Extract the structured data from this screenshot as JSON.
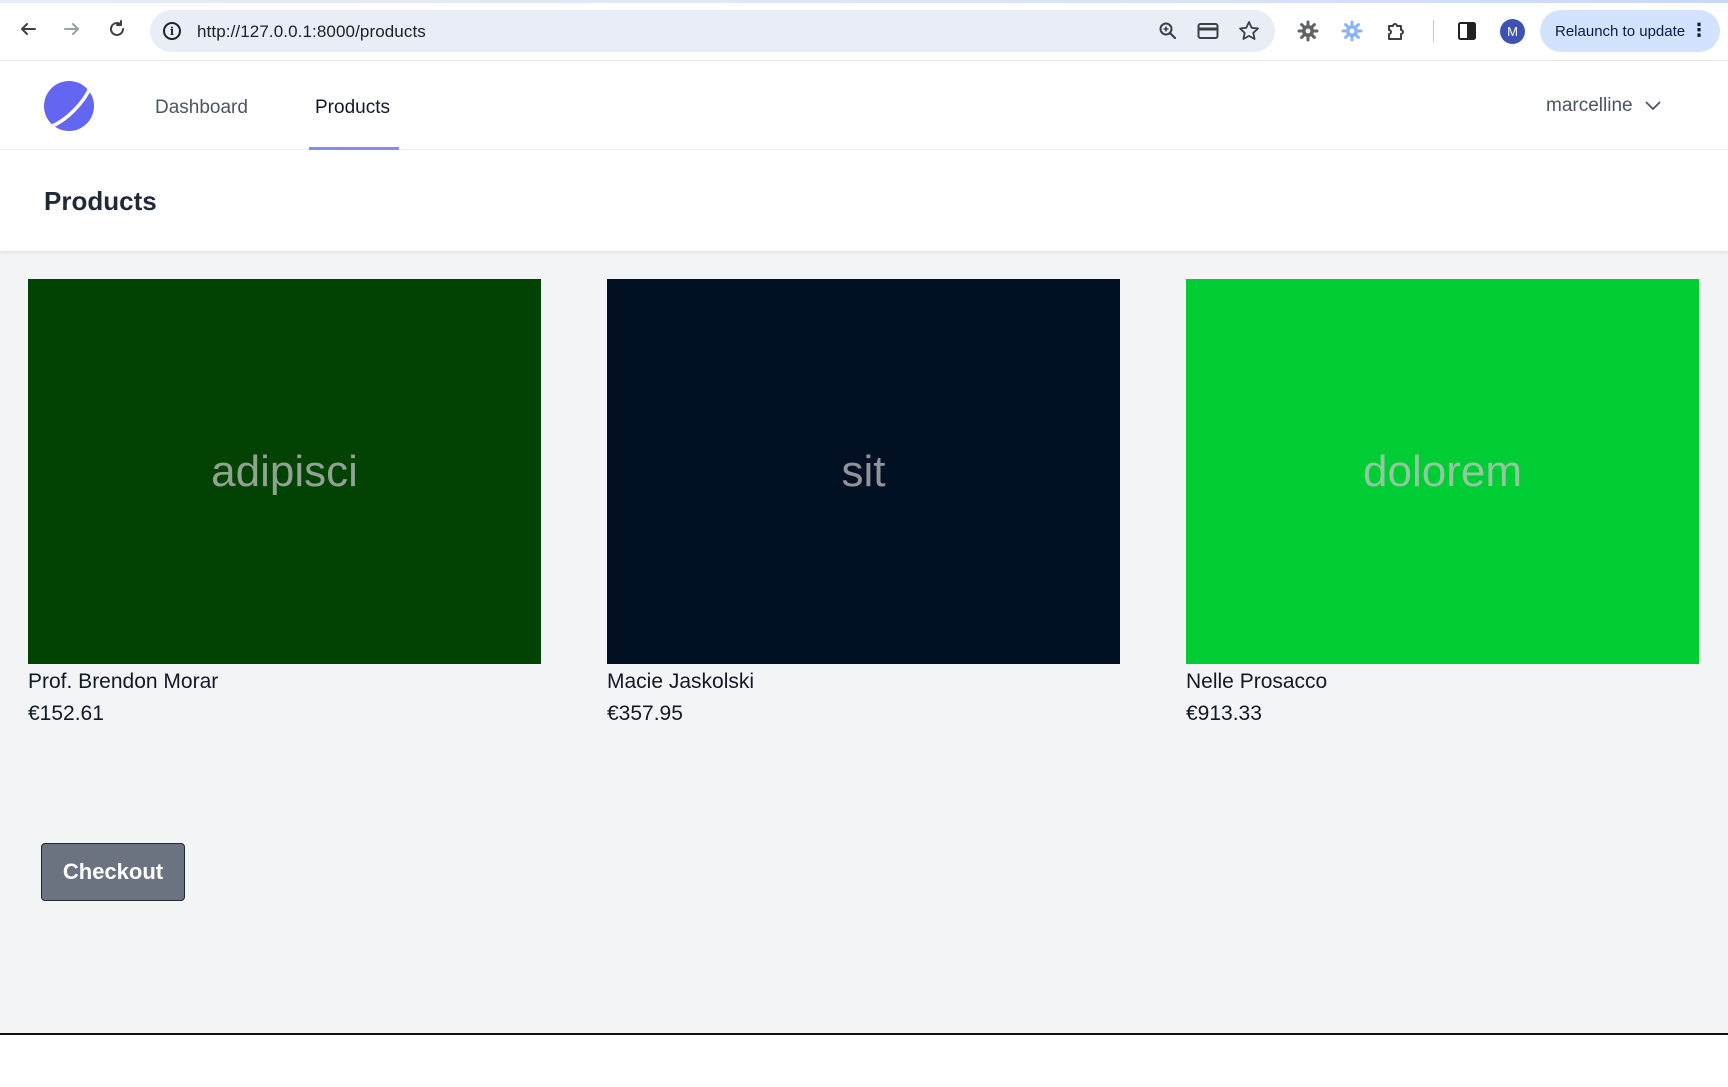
{
  "browser": {
    "url": "http://127.0.0.1:8000/products",
    "relaunch_label": "Relaunch to update",
    "profile_initial": "M",
    "info_glyph": "i"
  },
  "app": {
    "nav": {
      "dashboard_label": "Dashboard",
      "products_label": "Products",
      "active": "products"
    },
    "user": {
      "name": "marcelline"
    }
  },
  "page": {
    "title": "Products"
  },
  "products": [
    {
      "image_text": "adipisci",
      "image_color": "#024202",
      "name": "Prof. Brendon Morar",
      "price": "€152.61"
    },
    {
      "image_text": "sit",
      "image_color": "#011022",
      "name": "Macie Jaskolski",
      "price": "€357.95"
    },
    {
      "image_text": "dolorem",
      "image_color": "#00cc33",
      "name": "Nelle Prosacco",
      "price": "€913.33"
    }
  ],
  "checkout": {
    "label": "Checkout"
  },
  "colors": {
    "accent": "#818cf8",
    "logo": "#6366f1",
    "button": "#6b7280",
    "background": "#f3f4f6"
  }
}
